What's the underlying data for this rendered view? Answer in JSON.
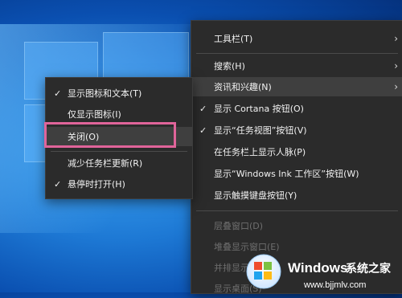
{
  "taskbar_menu": {
    "items": [
      {
        "label": "工具栏(T)",
        "submenu": true
      },
      {
        "label": "搜索(H)",
        "submenu": true
      },
      {
        "label": "资讯和兴趣(N)",
        "submenu": true,
        "highlighted": true
      },
      {
        "label": "显示 Cortana 按钮(O)",
        "checked": true
      },
      {
        "label": "显示“任务视图”按钮(V)",
        "checked": true
      },
      {
        "label": "在任务栏上显示人脉(P)"
      },
      {
        "label": "显示“Windows Ink 工作区”按钮(W)"
      },
      {
        "label": "显示触摸键盘按钮(Y)"
      },
      {
        "label": "层叠窗口(D)",
        "disabled": true
      },
      {
        "label": "堆叠显示窗口(E)",
        "disabled": true
      },
      {
        "label": "并排显示窗口(I)",
        "disabled": true
      },
      {
        "label": "显示桌面(S)",
        "disabled": true
      }
    ]
  },
  "submenu": {
    "items": [
      {
        "label": "显示图标和文本(T)",
        "checked": true
      },
      {
        "label": "仅显示图标(I)"
      },
      {
        "label": "关闭(O)",
        "highlighted": true
      },
      {
        "label": "减少任务栏更新(R)"
      },
      {
        "label": "悬停时打开(H)",
        "checked": true
      }
    ]
  },
  "icons": {
    "check": "✓",
    "chevron": "›"
  },
  "watermark": {
    "brand": "Windows",
    "cn": "系统之家",
    "url": "www.bjjmlv.com"
  },
  "colors": {
    "menu_bg": "#2b2b2b",
    "highlight": "#3f3f3f",
    "annotation_box": "#e0649a",
    "disabled_text": "#6f6f6f"
  }
}
